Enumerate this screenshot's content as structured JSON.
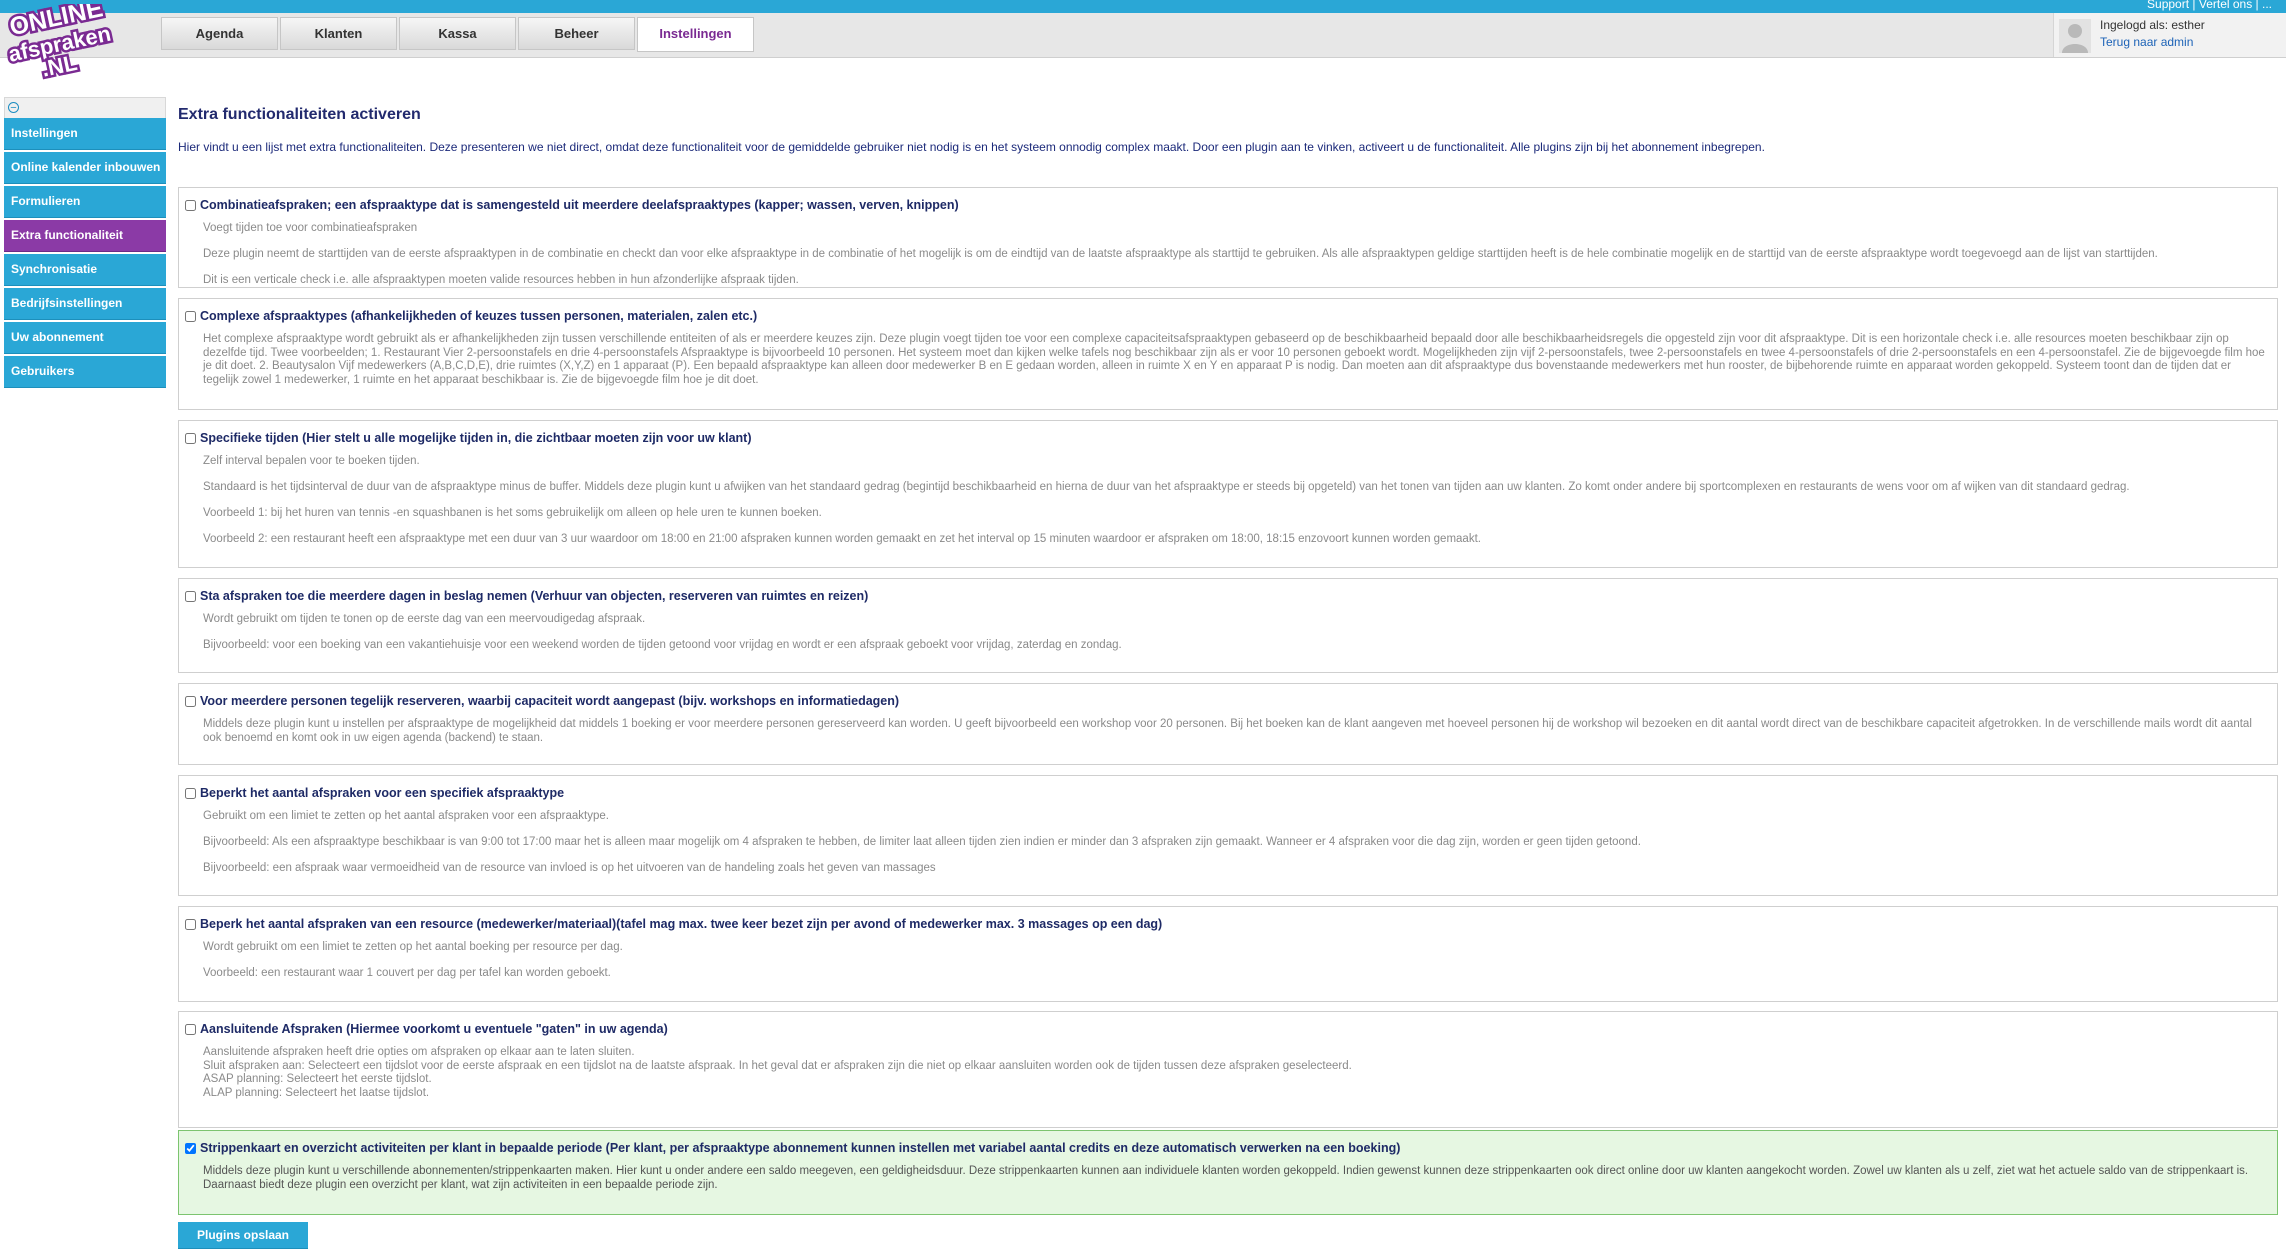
{
  "brand": {
    "logo_text": "ONLINE afspraken .NL",
    "colors": {
      "accent": "#2aa7d6",
      "active_purple": "#8b3aa6",
      "title_navy": "#222a6e",
      "checked_bg": "#e6f7e2"
    }
  },
  "top_links": "Support | Vertel ons | ...",
  "nav": {
    "tabs": [
      {
        "label": "Agenda"
      },
      {
        "label": "Klanten"
      },
      {
        "label": "Kassa"
      },
      {
        "label": "Beheer"
      },
      {
        "label": "Instellingen",
        "active": true
      }
    ]
  },
  "user": {
    "logged_in_label": "Ingelogd als: esther",
    "back_link": "Terug naar admin",
    "avatar_icon": "user-avatar-icon"
  },
  "sidebar": {
    "collapse_icon": "minus-circle-icon",
    "items": [
      {
        "label": "Instellingen"
      },
      {
        "label": "Online kalender inbouwen"
      },
      {
        "label": "Formulieren"
      },
      {
        "label": "Extra functionaliteit",
        "active": true
      },
      {
        "label": "Synchronisatie"
      },
      {
        "label": "Bedrijfsinstellingen"
      },
      {
        "label": "Uw abonnement"
      },
      {
        "label": "Gebruikers"
      }
    ]
  },
  "main": {
    "title": "Extra functionaliteiten activeren",
    "intro": "Hier vindt u een lijst met extra functionaliteiten. Deze presenteren we niet direct, omdat deze functionaliteit voor de gemiddelde gebruiker niet nodig is en het systeem onnodig complex maakt. Door een plugin aan te vinken, activeert u de functionaliteit. Alle plugins zijn bij het abonnement inbegrepen.",
    "plugins": [
      {
        "title": "Combinatieafspraken; een afspraaktype dat is samengesteld uit meerdere deelafspraaktypes (kapper; wassen, verven, knippen)",
        "checked": false,
        "desc": [
          "Voegt tijden toe voor combinatieafspraken",
          "Deze plugin neemt de starttijden van de eerste afspraaktypen in de combinatie en checkt dan voor elke afspraaktype in de combinatie of het mogelijk is om de eindtijd van de laatste afspraaktype als starttijd te gebruiken. Als alle afspraaktypen geldige starttijden heeft is de hele combinatie mogelijk en de starttijd van de eerste afspraaktype wordt toegevoegd aan de lijst van starttijden.",
          "Dit is een verticale check i.e. alle afspraaktypen moeten valide resources hebben in hun afzonderlijke afspraak tijden."
        ]
      },
      {
        "title": "Complexe afspraaktypes (afhankelijkheden of keuzes tussen personen, materialen, zalen etc.)",
        "checked": false,
        "desc": [
          "Het complexe afspraaktype wordt gebruikt als er afhankelijkheden zijn tussen verschillende entiteiten of als er meerdere keuzes zijn. Deze plugin voegt tijden toe voor een complexe capaciteitsafspraaktypen gebaseerd op de beschikbaarheid bepaald door alle beschikbaarheidsregels die opgesteld zijn voor dit afspraaktype. Dit is een horizontale check i.e. alle resources moeten beschikbaar zijn op dezelfde tijd. Twee voorbeelden; 1. Restaurant Vier 2-persoonstafels en drie 4-persoonstafels Afspraaktype is bijvoorbeeld 10 personen. Het systeem moet dan kijken welke tafels nog beschikbaar zijn als er voor 10 personen geboekt wordt. Mogelijkheden zijn vijf 2-persoonstafels, twee 2-persoonstafels en twee 4-persoonstafels of drie 2-persoonstafels en een 4-persoonstafel. Zie de bijgevoegde film hoe je dit doet. 2. Beautysalon Vijf medewerkers (A,B,C,D,E), drie ruimtes (X,Y,Z) en 1 apparaat (P). Een bepaald afspraaktype kan alleen door medewerker B en E gedaan worden, alleen in ruimte X en Y en apparaat P is nodig. Dan moeten aan dit afspraaktype dus bovenstaande medewerkers met hun rooster, de bijbehorende ruimte en apparaat worden gekoppeld. Systeem toont dan de tijden dat er tegelijk zowel 1 medewerker, 1 ruimte en het apparaat beschikbaar is. Zie de bijgevoegde film hoe je dit doet."
        ]
      },
      {
        "title": "Specifieke tijden (Hier stelt u alle mogelijke tijden in, die zichtbaar moeten zijn voor uw klant)",
        "checked": false,
        "desc": [
          "Zelf interval bepalen voor te boeken tijden.",
          "Standaard is het tijdsinterval de duur van de afspraaktype minus de buffer. Middels deze plugin kunt u afwijken van het standaard gedrag (begintijd beschikbaarheid en hierna de duur van het afspraaktype er steeds bij opgeteld) van het tonen van tijden aan uw klanten. Zo komt onder andere bij sportcomplexen en restaurants de wens voor om af wijken van dit standaard gedrag.",
          "Voorbeeld 1: bij het huren van tennis -en squashbanen is het soms gebruikelijk om alleen op hele uren te kunnen boeken.",
          "Voorbeeld 2: een restaurant heeft een afspraaktype met een duur van 3 uur waardoor om 18:00 en 21:00 afspraken kunnen worden gemaakt en zet het interval op 15 minuten waardoor er afspraken om 18:00, 18:15 enzovoort kunnen worden gemaakt."
        ]
      },
      {
        "title": "Sta afspraken toe die meerdere dagen in beslag nemen (Verhuur van objecten, reserveren van ruimtes en reizen)",
        "checked": false,
        "desc": [
          "Wordt gebruikt om tijden te tonen op de eerste dag van een meervoudigedag afspraak.",
          "Bijvoorbeeld: voor een boeking van een vakantiehuisje voor een weekend worden de tijden getoond voor vrijdag en wordt er een afspraak geboekt voor vrijdag, zaterdag en zondag."
        ]
      },
      {
        "title": "Voor meerdere personen tegelijk reserveren, waarbij capaciteit wordt aangepast (bijv. workshops en informatiedagen)",
        "checked": false,
        "desc": [
          "Middels deze plugin kunt u instellen per afspraaktype de mogelijkheid dat middels 1 boeking er voor meerdere personen gereserveerd kan worden. U geeft bijvoorbeeld een workshop voor 20 personen. Bij het boeken kan de klant aangeven met hoeveel personen hij de workshop wil bezoeken en dit aantal wordt direct van de beschikbare capaciteit afgetrokken. In de verschillende mails wordt dit aantal ook benoemd en komt ook in uw eigen agenda (backend) te staan."
        ]
      },
      {
        "title": "Beperkt het aantal afspraken voor een specifiek afspraaktype",
        "checked": false,
        "desc": [
          "Gebruikt om een limiet te zetten op het aantal afspraken voor een afspraaktype.",
          "Bijvoorbeeld: Als een afspraaktype beschikbaar is van 9:00 tot 17:00 maar het is alleen maar mogelijk om 4 afspraken te hebben, de limiter laat alleen tijden zien indien er minder dan 3 afspraken zijn gemaakt. Wanneer er 4 afspraken voor die dag zijn, worden er geen tijden getoond.",
          "Bijvoorbeeld: een afspraak waar vermoeidheid van de resource van invloed is op het uitvoeren van de handeling zoals het geven van massages"
        ]
      },
      {
        "title": "Beperk het aantal afspraken van een resource (medewerker/materiaal)(tafel mag max. twee keer bezet zijn per avond of medewerker max. 3 massages op een dag)",
        "checked": false,
        "desc": [
          "Wordt gebruikt om een limiet te zetten op het aantal boeking per resource per dag.",
          "Voorbeeld: een restaurant waar 1 couvert per dag per tafel kan worden geboekt."
        ]
      },
      {
        "title": "Aansluitende Afspraken (Hiermee voorkomt u eventuele \"gaten\" in uw agenda)",
        "checked": false,
        "desc_lines": [
          "Aansluitende afspraken heeft drie opties om afspraken op elkaar aan te laten sluiten.",
          "Sluit afspraken aan: Selecteert een tijdslot voor de eerste afspraak en een tijdslot na de laatste afspraak. In het geval dat er afspraken zijn die niet op elkaar aansluiten worden ook de tijden tussen deze afspraken geselecteerd.",
          "ASAP planning: Selecteert het eerste tijdslot.",
          "ALAP planning: Selecteert het laatse tijdslot."
        ]
      },
      {
        "title": "Strippenkaart en overzicht activiteiten per klant in bepaalde periode (Per klant, per afspraaktype abonnement kunnen instellen met variabel aantal credits en deze automatisch verwerken na een boeking)",
        "checked": true,
        "desc": [
          "Middels deze plugin kunt u verschillende abonnementen/strippenkaarten maken. Hier kunt u onder andere een saldo meegeven, een geldigheidsduur. Deze strippenkaarten kunnen aan individuele klanten worden gekoppeld. Indien gewenst kunnen deze strippenkaarten ook direct online door uw klanten aangekocht worden. Zowel uw klanten als u zelf, ziet wat het actuele saldo van de strippenkaart is. Daarnaast biedt deze plugin een overzicht per klant, wat zijn activiteiten in een bepaalde periode zijn."
        ]
      }
    ],
    "save_button": "Plugins opslaan"
  }
}
